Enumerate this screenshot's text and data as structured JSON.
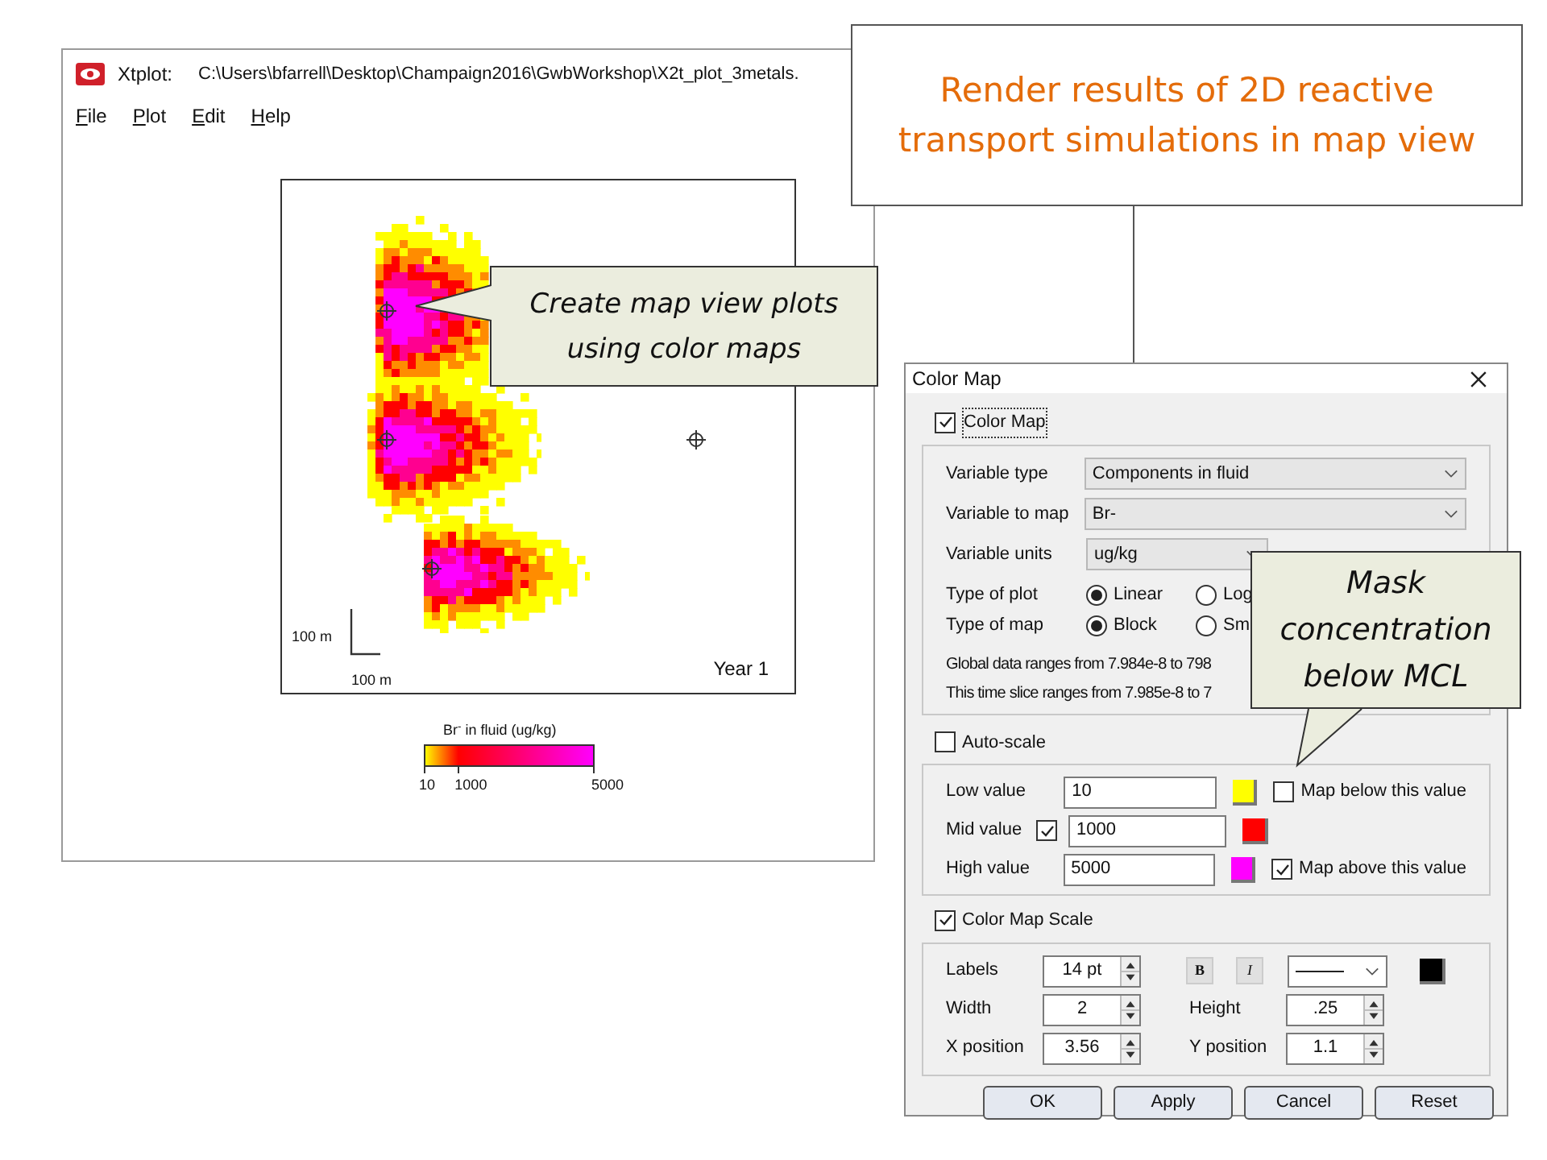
{
  "slide_callout": {
    "text": "Render results of 2D reactive transport simulations in map view"
  },
  "plot_window": {
    "app": "Xtplot:",
    "path": "C:\\Users\\bfarrell\\Desktop\\Champaign2016\\GwbWorkshop\\X2t_plot_3metals.",
    "menu": [
      "File",
      "Plot",
      "Edit",
      "Help"
    ],
    "plot": {
      "scale_vertical": "100 m",
      "scale_horizontal": "100 m",
      "year": "Year 1"
    },
    "colorbar": {
      "title": "Br$^{-}$ in fluid (ug/kg)",
      "ticks": [
        "10",
        "1000",
        "5000"
      ]
    }
  },
  "map_callout": {
    "text": "Create map view plots using color maps"
  },
  "dialog": {
    "title": "Color Map",
    "enable": {
      "label": "Color Map",
      "checked": true
    },
    "variables": [
      {
        "label": "Variable type",
        "value": "Components in fluid",
        "kind": "wide"
      },
      {
        "label": "Variable to map",
        "value": "Br-",
        "kind": "wide"
      },
      {
        "label": "Variable units",
        "value": "ug/kg",
        "kind": "narrow"
      }
    ],
    "radio_groups": [
      {
        "label": "Type of plot",
        "options": [
          {
            "label": "Linear",
            "selected": true
          },
          {
            "label": "Log",
            "selected": false
          }
        ]
      },
      {
        "label": "Type of map",
        "options": [
          {
            "label": "Block",
            "selected": true
          },
          {
            "label": "Sm",
            "selected": false
          }
        ]
      }
    ],
    "ranges": [
      "Global data ranges from 7.984e-8 to 798",
      "This time slice ranges from 7.985e-8 to 7"
    ],
    "auto_scale": {
      "label": "Auto-scale",
      "checked": false
    },
    "values": [
      {
        "label": "Low value",
        "value": "10",
        "color": "#ffff00",
        "mask": {
          "label": "Map below this value",
          "checked": false
        }
      },
      {
        "label": "Mid value",
        "checked": true,
        "value": "1000",
        "color": "#ff0000"
      },
      {
        "label": "High value",
        "value": "5000",
        "color": "#ff00ff",
        "mask": {
          "label": "Map above this value",
          "checked": true
        }
      }
    ],
    "scale": {
      "label": "Color Map Scale",
      "checked": true,
      "labels": {
        "label": "Labels",
        "value": "14 pt"
      },
      "bold": "B",
      "italic": "I",
      "width": {
        "label": "Width",
        "value": "2"
      },
      "height": {
        "label": "Height",
        "value": ".25"
      },
      "x_position": {
        "label": "X position",
        "value": "3.56"
      },
      "y_position": {
        "label": "Y position",
        "value": "1.1"
      }
    },
    "buttons": [
      "OK",
      "Apply",
      "Cancel",
      "Reset"
    ]
  },
  "mask_callout": {
    "text": "Mask concentration below MCL"
  }
}
